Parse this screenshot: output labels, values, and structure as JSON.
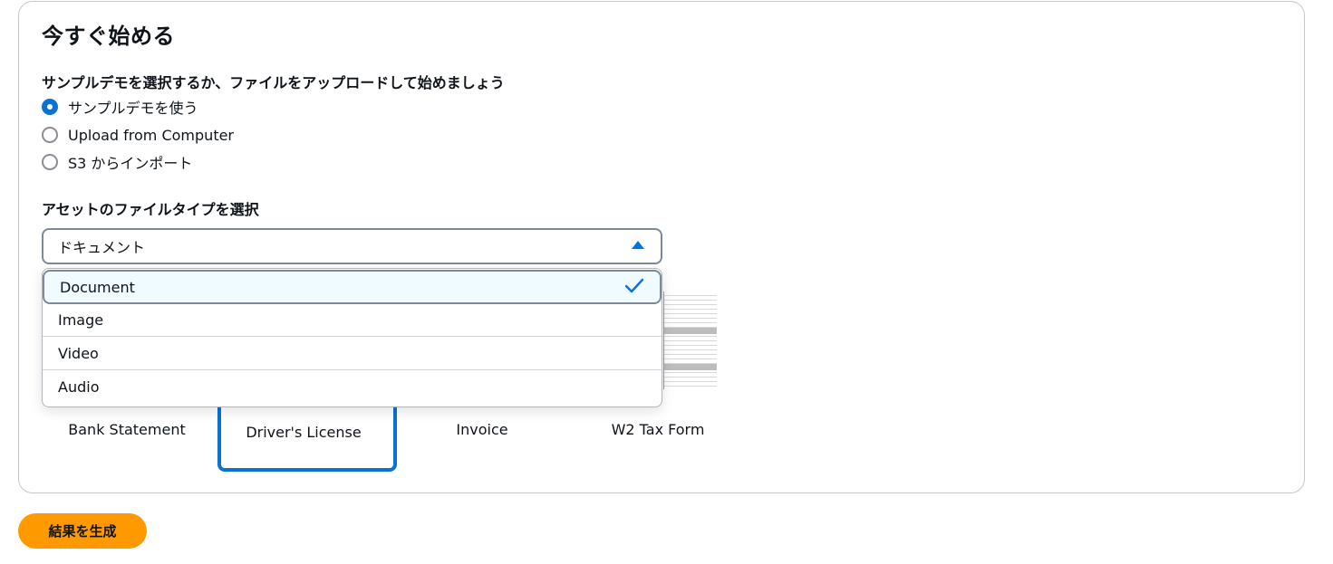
{
  "section": {
    "title": "今すぐ始める",
    "source_label": "サンプルデモを選択するか、ファイルをアップロードして始めましょう",
    "source_options": [
      {
        "label": "サンプルデモを使う",
        "selected": true
      },
      {
        "label": "Upload from Computer",
        "selected": false
      },
      {
        "label": "S3 からインポート",
        "selected": false
      }
    ],
    "asset_type_label": "アセットのファイルタイプを選択",
    "asset_type_value": "ドキュメント",
    "asset_type_options": [
      {
        "label": "Document",
        "selected": true
      },
      {
        "label": "Image",
        "selected": false
      },
      {
        "label": "Video",
        "selected": false
      },
      {
        "label": "Audio",
        "selected": false
      }
    ],
    "samples": [
      "Bank Statement",
      "Driver's License",
      "Invoice",
      "W2 Tax Form"
    ],
    "selected_sample": "Driver's License"
  },
  "actions": {
    "generate_label": "結果を生成"
  },
  "colors": {
    "accent": "#0972d3",
    "primary_button": "#ff9900"
  }
}
